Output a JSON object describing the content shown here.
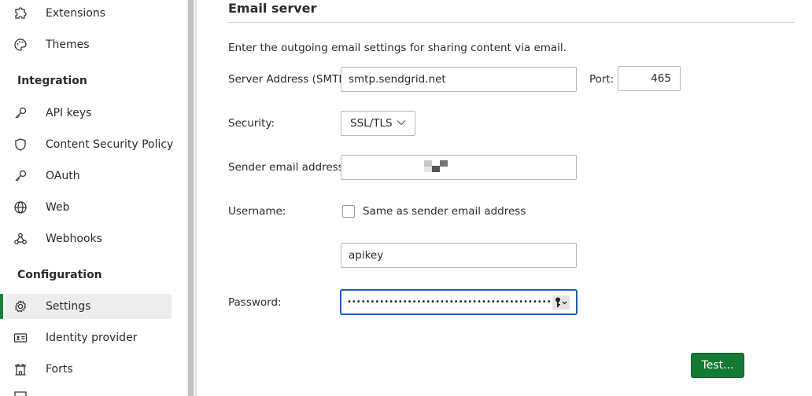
{
  "sidebar": {
    "items_top": [
      {
        "label": "Extensions",
        "icon": "puzzle-icon"
      },
      {
        "label": "Themes",
        "icon": "palette-icon"
      }
    ],
    "integration_title": "Integration",
    "integration_items": [
      {
        "label": "API keys",
        "icon": "key-icon"
      },
      {
        "label": "Content Security Policy",
        "icon": "shield-icon"
      },
      {
        "label": "OAuth",
        "icon": "key-icon"
      },
      {
        "label": "Web",
        "icon": "globe-icon"
      },
      {
        "label": "Webhooks",
        "icon": "webhook-icon"
      }
    ],
    "configuration_title": "Configuration",
    "configuration_items": [
      {
        "label": "Settings",
        "icon": "gear-icon",
        "active": true
      },
      {
        "label": "Identity provider",
        "icon": "id-card-icon"
      },
      {
        "label": "Forts",
        "icon": "fort-icon"
      }
    ],
    "accent_color": "#1a7f37"
  },
  "email_server": {
    "title": "Email server",
    "description": "Enter the outgoing email settings for sharing content via email.",
    "server_address_label": "Server Address (SMTP):",
    "server_address_value": "smtp.sendgrid.net",
    "port_label": "Port:",
    "port_value": "465",
    "security_label": "Security:",
    "security_value": "SSL/TLS",
    "sender_label": "Sender email address:",
    "sender_value": "",
    "username_label": "Username:",
    "same_as_sender_label": "Same as sender email address",
    "same_as_sender_checked": false,
    "username_value": "apikey",
    "password_label": "Password:",
    "password_value": "•••••••••••••••••••••••••••••••••••••••••••••••••••••••••••",
    "test_button_label": "Test...",
    "button_color": "#157a32",
    "focus_color": "#1a5fb4"
  }
}
